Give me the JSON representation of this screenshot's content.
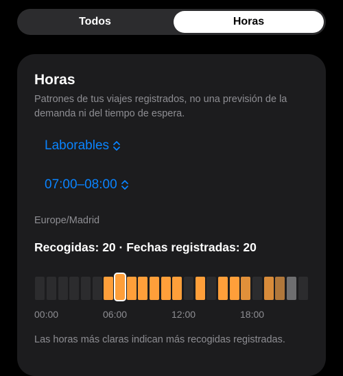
{
  "segmented": {
    "options": [
      "Todos",
      "Horas"
    ],
    "selected": "Horas"
  },
  "card": {
    "title": "Horas",
    "subtitle": "Patrones de tus viajes registrados, no una previsión de la demanda ni del tiempo de espera.",
    "day_picker": "Laborables",
    "hour_picker": "07:00–08:00",
    "timezone": "Europe/Madrid",
    "stats": "Recogidas: 20 · Fechas registradas: 20",
    "footnote": "Las horas más claras indican más recogidas registradas.",
    "accent_color": "#0a84ff",
    "highlight_color": "#ff9f3a"
  },
  "chart_data": {
    "type": "heatmap",
    "x_tick_labels": [
      "00:00",
      "06:00",
      "12:00",
      "18:00"
    ],
    "selected_hour": 7,
    "hours": [
      {
        "hour": 0,
        "level": 0
      },
      {
        "hour": 1,
        "level": 0
      },
      {
        "hour": 2,
        "level": 0
      },
      {
        "hour": 3,
        "level": 0
      },
      {
        "hour": 4,
        "level": 0
      },
      {
        "hour": 5,
        "level": 0
      },
      {
        "hour": 6,
        "level": 1
      },
      {
        "hour": 7,
        "level": 1
      },
      {
        "hour": 8,
        "level": 1
      },
      {
        "hour": 9,
        "level": 1
      },
      {
        "hour": 10,
        "level": 1
      },
      {
        "hour": 11,
        "level": 1
      },
      {
        "hour": 12,
        "level": 1
      },
      {
        "hour": 13,
        "level": 0
      },
      {
        "hour": 14,
        "level": 1
      },
      {
        "hour": 15,
        "level": 0
      },
      {
        "hour": 16,
        "level": 1
      },
      {
        "hour": 17,
        "level": 1
      },
      {
        "hour": 18,
        "level": 0.85
      },
      {
        "hour": 19,
        "level": 0
      },
      {
        "hour": 20,
        "level": 0.8
      },
      {
        "hour": 21,
        "level": 0.6
      },
      {
        "hour": 22,
        "level": 0.3
      },
      {
        "hour": 23,
        "level": 0
      }
    ]
  }
}
